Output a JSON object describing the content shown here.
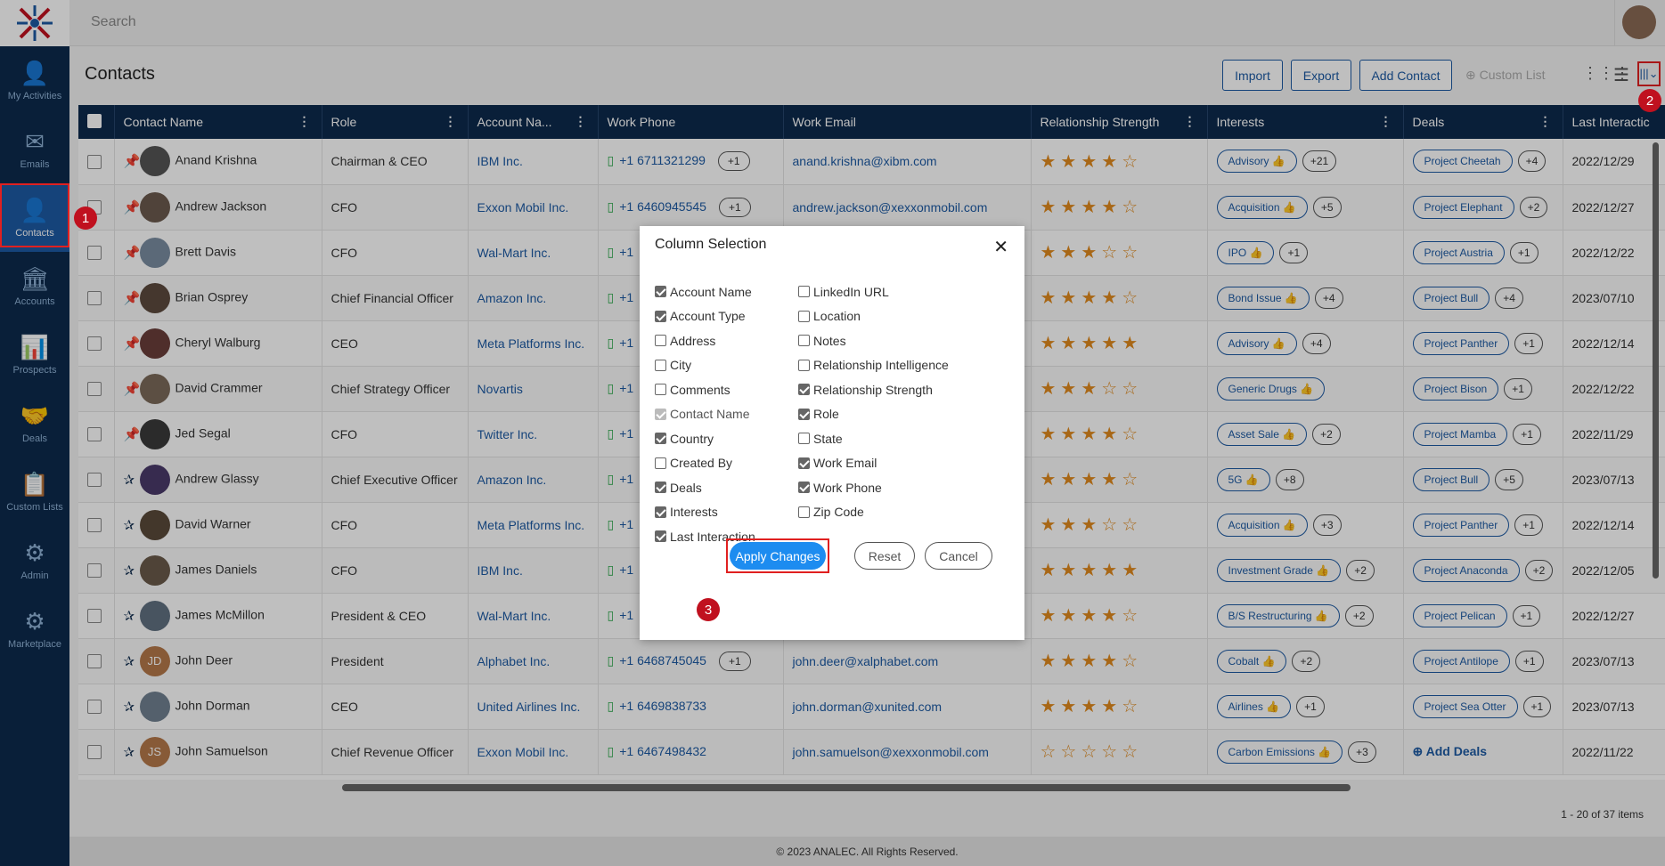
{
  "app": {
    "search_placeholder": "Search",
    "footer": "© 2023 ANALEC. All Rights Reserved."
  },
  "sidebar": {
    "items": [
      {
        "label": "My Activities",
        "icon": "user-activity-icon"
      },
      {
        "label": "Emails",
        "icon": "envelope-icon"
      },
      {
        "label": "Contacts",
        "icon": "contacts-icon",
        "active": true
      },
      {
        "label": "Accounts",
        "icon": "bank-icon"
      },
      {
        "label": "Prospects",
        "icon": "prospects-chart-icon"
      },
      {
        "label": "Deals",
        "icon": "handshake-icon"
      },
      {
        "label": "Custom Lists",
        "icon": "list-icon"
      },
      {
        "label": "Admin",
        "icon": "admin-gear-icon"
      },
      {
        "label": "Marketplace",
        "icon": "marketplace-icon"
      }
    ]
  },
  "page": {
    "title": "Contacts",
    "buttons": {
      "import": "Import",
      "export": "Export",
      "add_contact": "Add Contact",
      "custom_list": "Custom List"
    },
    "pagination": "1 - 20 of 37 items"
  },
  "table": {
    "columns": [
      "Contact Name",
      "Role",
      "Account Na...",
      "Work Phone",
      "Work Email",
      "Relationship Strength",
      "Interests",
      "Deals",
      "Last Interactic"
    ],
    "rows": [
      {
        "name": "Anand Krishna",
        "role": "Chairman & CEO",
        "account": "IBM Inc.",
        "phone": "+1 6711321299",
        "phone_more": "+1",
        "email": "anand.krishna@xibm.com",
        "stars": 4,
        "interest": "Advisory",
        "interest_more": "+21",
        "deal": "Project Cheetah",
        "deal_more": "+4",
        "last": "2022/12/29",
        "pinned": true
      },
      {
        "name": "Andrew Jackson",
        "role": "CFO",
        "account": "Exxon Mobil Inc.",
        "phone": "+1 6460945545",
        "phone_more": "+1",
        "email": "andrew.jackson@xexxonmobil.com",
        "stars": 4,
        "interest": "Acquisition",
        "interest_more": "+5",
        "deal": "Project Elephant",
        "deal_more": "+2",
        "last": "2022/12/27",
        "pinned": true
      },
      {
        "name": "Brett Davis",
        "role": "CFO",
        "account": "Wal-Mart Inc.",
        "phone": "+1",
        "phone_more": "",
        "email": "",
        "stars": 3,
        "interest": "IPO",
        "interest_more": "+1",
        "deal": "Project Austria",
        "deal_more": "+1",
        "last": "2022/12/22",
        "pinned": true
      },
      {
        "name": "Brian Osprey",
        "role": "Chief Financial Officer",
        "account": "Amazon Inc.",
        "phone": "+1",
        "phone_more": "",
        "email": "",
        "stars": 4,
        "interest": "Bond Issue",
        "interest_more": "+4",
        "deal": "Project Bull",
        "deal_more": "+4",
        "last": "2023/07/10",
        "pinned": true
      },
      {
        "name": "Cheryl Walburg",
        "role": "CEO",
        "account": "Meta Platforms Inc.",
        "phone": "+1",
        "phone_more": "",
        "email": "",
        "stars": 5,
        "interest": "Advisory",
        "interest_more": "+4",
        "deal": "Project Panther",
        "deal_more": "+1",
        "last": "2022/12/14",
        "pinned": true
      },
      {
        "name": "David Crammer",
        "role": "Chief Strategy Officer",
        "account": "Novartis",
        "phone": "+1",
        "phone_more": "",
        "email": "",
        "stars": 3,
        "interest": "Generic Drugs",
        "interest_more": "",
        "deal": "Project Bison",
        "deal_more": "+1",
        "last": "2022/12/22",
        "pinned": true
      },
      {
        "name": "Jed Segal",
        "role": "CFO",
        "account": "Twitter Inc.",
        "phone": "+1",
        "phone_more": "",
        "email": "",
        "stars": 4,
        "interest": "Asset Sale",
        "interest_more": "+2",
        "deal": "Project Mamba",
        "deal_more": "+1",
        "last": "2022/11/29",
        "pinned": true
      },
      {
        "name": "Andrew Glassy",
        "role": "Chief Executive Officer",
        "account": "Amazon Inc.",
        "phone": "+1",
        "phone_more": "",
        "email": "",
        "stars": 4,
        "interest": "5G",
        "interest_more": "+8",
        "deal": "Project Bull",
        "deal_more": "+5",
        "last": "2023/07/13",
        "pinned": false
      },
      {
        "name": "David Warner",
        "role": "CFO",
        "account": "Meta Platforms Inc.",
        "phone": "+1",
        "phone_more": "",
        "email": "",
        "stars": 3,
        "interest": "Acquisition",
        "interest_more": "+3",
        "deal": "Project Panther",
        "deal_more": "+1",
        "last": "2022/12/14",
        "pinned": false
      },
      {
        "name": "James Daniels",
        "role": "CFO",
        "account": "IBM Inc.",
        "phone": "+1",
        "phone_more": "",
        "email": "",
        "stars": 5,
        "interest": "Investment Grade",
        "interest_more": "+2",
        "deal": "Project Anaconda",
        "deal_more": "+2",
        "last": "2022/12/05",
        "pinned": false
      },
      {
        "name": "James McMillon",
        "role": "President & CEO",
        "account": "Wal-Mart Inc.",
        "phone": "+1",
        "phone_more": "",
        "email": "",
        "stars": 4,
        "interest": "B/S Restructuring",
        "interest_more": "+2",
        "deal": "Project Pelican",
        "deal_more": "+1",
        "last": "2022/12/27",
        "pinned": false
      },
      {
        "name": "John Deer",
        "role": "President",
        "account": "Alphabet Inc.",
        "phone": "+1 6468745045",
        "phone_more": "+1",
        "email": "john.deer@xalphabet.com",
        "stars": 4,
        "interest": "Cobalt",
        "interest_more": "+2",
        "deal": "Project Antilope",
        "deal_more": "+1",
        "last": "2023/07/13",
        "pinned": false,
        "initials": "JD"
      },
      {
        "name": "John Dorman",
        "role": "CEO",
        "account": "United Airlines Inc.",
        "phone": "+1 6469838733",
        "phone_more": "",
        "email": "john.dorman@xunited.com",
        "stars": 4,
        "interest": "Airlines",
        "interest_more": "+1",
        "deal": "Project Sea Otter",
        "deal_more": "+1",
        "last": "2023/07/13",
        "pinned": false
      },
      {
        "name": "John Samuelson",
        "role": "Chief Revenue Officer",
        "account": "Exxon Mobil Inc.",
        "phone": "+1 6467498432",
        "phone_more": "",
        "email": "john.samuelson@xexxonmobil.com",
        "stars": 0,
        "interest": "Carbon Emissions",
        "interest_more": "+3",
        "deal": "Add Deals",
        "deal_more": "",
        "last": "2022/11/22",
        "pinned": false,
        "initials": "JS"
      }
    ]
  },
  "modal": {
    "title": "Column Selection",
    "left": [
      {
        "label": "Account Name",
        "checked": true
      },
      {
        "label": "Account Type",
        "checked": true
      },
      {
        "label": "Address",
        "checked": false
      },
      {
        "label": "City",
        "checked": false
      },
      {
        "label": "Comments",
        "checked": false
      },
      {
        "label": "Contact Name",
        "checked": true,
        "disabled": true
      },
      {
        "label": "Country",
        "checked": true
      },
      {
        "label": "Created By",
        "checked": false
      },
      {
        "label": "Deals",
        "checked": true
      },
      {
        "label": "Interests",
        "checked": true
      },
      {
        "label": "Last Interaction",
        "checked": true
      }
    ],
    "right": [
      {
        "label": "LinkedIn URL",
        "checked": false
      },
      {
        "label": "Location",
        "checked": false
      },
      {
        "label": "Notes",
        "checked": false
      },
      {
        "label": "Relationship Intelligence",
        "checked": false
      },
      {
        "label": "Relationship Strength",
        "checked": true
      },
      {
        "label": "Role",
        "checked": true
      },
      {
        "label": "State",
        "checked": false
      },
      {
        "label": "Work Email",
        "checked": true
      },
      {
        "label": "Work Phone",
        "checked": true
      },
      {
        "label": "Zip Code",
        "checked": false
      }
    ],
    "apply": "Apply Changes",
    "reset": "Reset",
    "cancel": "Cancel"
  },
  "markers": [
    "1",
    "2",
    "3"
  ],
  "colors": {
    "sidebar": "#0d2a4c",
    "accent": "#1d5aa3",
    "star": "#e08a1e",
    "marker": "#c0111f"
  }
}
